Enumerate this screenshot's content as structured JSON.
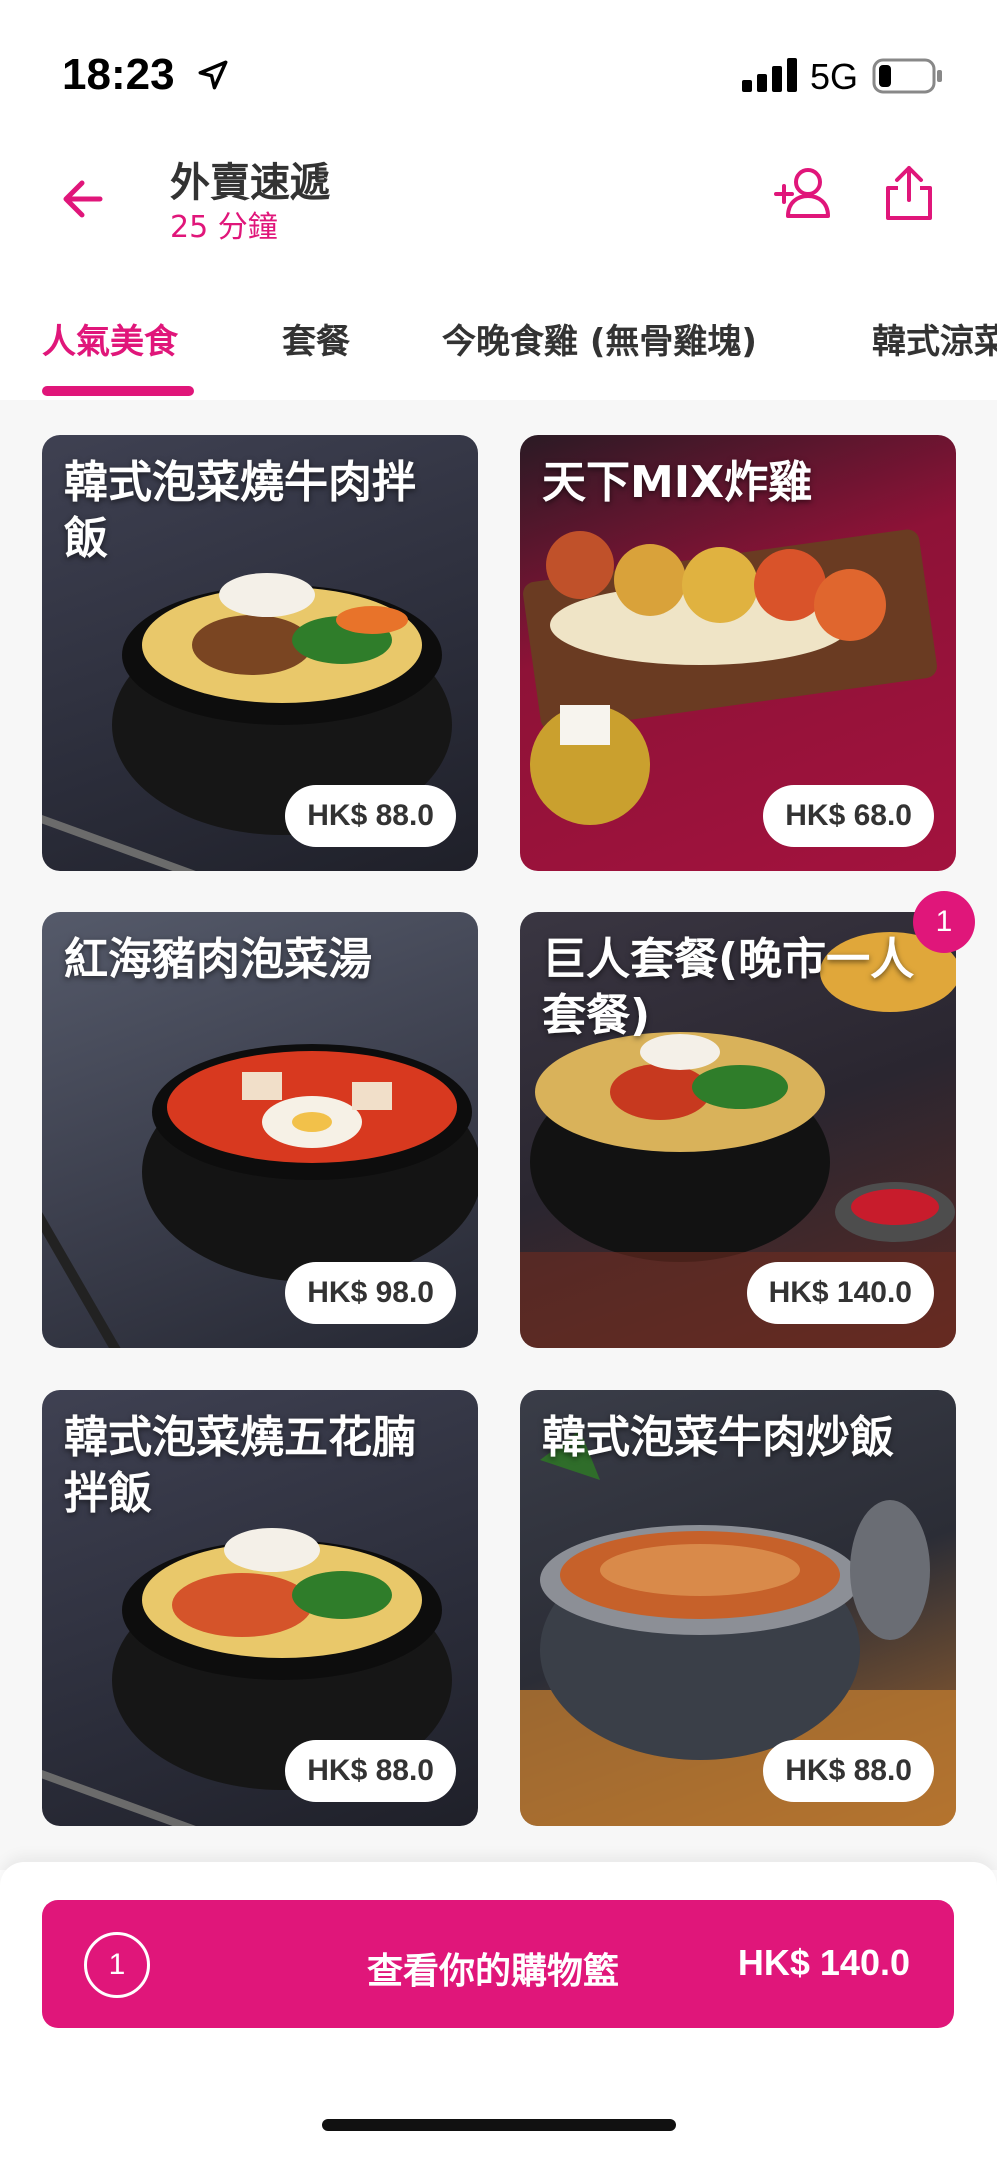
{
  "status": {
    "time": "18:23",
    "network": "5G"
  },
  "header": {
    "title": "外賣速遞",
    "subtitle": "25 分鐘"
  },
  "tabs": [
    "人氣美食",
    "套餐",
    "今晚食雞 (無骨雞塊)",
    "韓式涼菜"
  ],
  "items": [
    {
      "name": "韓式泡菜燒牛肉拌飯",
      "price": "HK$ 88.0"
    },
    {
      "name": "天下MIX炸雞",
      "price": "HK$ 68.0"
    },
    {
      "name": "紅海豬肉泡菜湯",
      "price": "HK$ 98.0"
    },
    {
      "name": "巨人套餐(晚市一人套餐)",
      "price": "HK$ 140.0",
      "badge": "1"
    },
    {
      "name": "韓式泡菜燒五花腩拌飯",
      "price": "HK$ 88.0"
    },
    {
      "name": "韓式泡菜牛肉炒飯",
      "price": "HK$ 88.0"
    }
  ],
  "cart": {
    "count": "1",
    "label": "查看你的購物籃",
    "total": "HK$ 140.0"
  },
  "colors": {
    "accent": "#e0167a"
  },
  "icons": [
    "location-arrow-icon",
    "signal-icon",
    "battery-icon",
    "back-arrow-icon",
    "add-user-icon",
    "share-icon"
  ]
}
